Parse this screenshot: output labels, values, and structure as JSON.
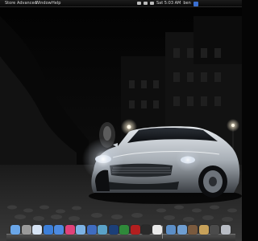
{
  "menubar": {
    "items": [
      {
        "label": "Store"
      },
      {
        "label": "Advanced"
      },
      {
        "label": "Window"
      },
      {
        "label": "Help"
      }
    ],
    "status": {
      "clock": "Sat 5:03 AM",
      "user": "ben"
    }
  },
  "dock": {
    "apps": [
      {
        "icon": "finder-icon",
        "color": "#6aa6e8"
      },
      {
        "icon": "system-preferences-icon",
        "color": "#9a9a9a"
      },
      {
        "icon": "mail-icon",
        "color": "#d6e3f4"
      },
      {
        "icon": "safari-icon",
        "color": "#3d7fd8"
      },
      {
        "icon": "ichat-icon",
        "color": "#4d8be0"
      },
      {
        "icon": "itunes-icon",
        "color": "#e0427a"
      },
      {
        "icon": "iphoto-icon",
        "color": "#7db3e4"
      },
      {
        "icon": "spaces-icon",
        "color": "#3f6cc0"
      },
      {
        "icon": "time-machine-icon",
        "color": "#5aa2c8"
      },
      {
        "icon": "photoshop-icon",
        "color": "#1c3f78"
      },
      {
        "icon": "dreamweaver-icon",
        "color": "#2f8a3a"
      },
      {
        "icon": "flash-icon",
        "color": "#b31f1f"
      },
      {
        "icon": "terminal-icon",
        "color": "#2a2a2a"
      },
      {
        "icon": "textedit-icon",
        "color": "#e8e8e8"
      }
    ],
    "docs": [
      {
        "icon": "applications-folder-icon",
        "color": "#5c8ec6"
      },
      {
        "icon": "documents-folder-icon",
        "color": "#6f9ed1"
      },
      {
        "icon": "downloads-stack-icon",
        "color": "#7a5a3e"
      },
      {
        "icon": "pictures-stack-icon",
        "color": "#c7a15a"
      },
      {
        "icon": "movies-folder-icon",
        "color": "#4b4b4b"
      },
      {
        "icon": "trash-icon",
        "color": "#b8bcc4"
      }
    ]
  }
}
